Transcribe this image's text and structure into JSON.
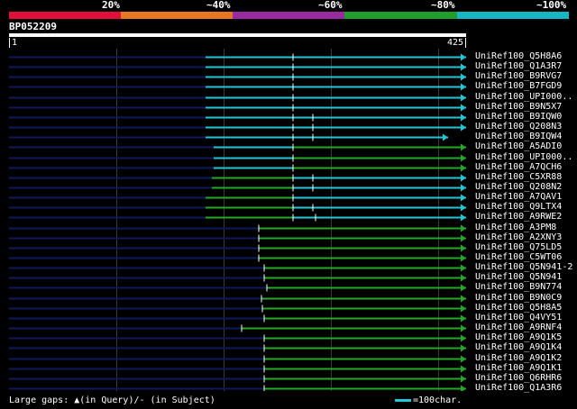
{
  "scale": {
    "segments": [
      {
        "color": "#e0103a"
      },
      {
        "color": "#e87722"
      },
      {
        "color": "#9a2aa0"
      },
      {
        "color": "#1e9e2a"
      },
      {
        "color": "#17b6c2"
      }
    ],
    "labels": [
      "20%",
      "~40%",
      "~60%",
      "~80%",
      "~100%"
    ]
  },
  "query": {
    "id": "BP052209",
    "start": "1",
    "end": "425",
    "length": 425
  },
  "colors": {
    "cyan": "#22c7d6",
    "green": "#23a828",
    "navy": "#101a5a",
    "white": "#ffffff"
  },
  "hits": [
    {
      "label": "UniRef100_Q5H8A6"
    },
    {
      "label": "UniRef100_Q1A3R7"
    },
    {
      "label": "UniRef100_B9RVG7"
    },
    {
      "label": "UniRef100_B7FGD9"
    },
    {
      "label": "UniRef100_UPI000.."
    },
    {
      "label": "UniRef100_B9N5X7"
    },
    {
      "label": "UniRef100_B9IQW0"
    },
    {
      "label": "UniRef100_Q208N3"
    },
    {
      "label": "UniRef100_B9IQW4"
    },
    {
      "label": "UniRef100_A5ADI0"
    },
    {
      "label": "UniRef100_UPI000.."
    },
    {
      "label": "UniRef100_A7QCH6"
    },
    {
      "label": "UniRef100_C5XR88"
    },
    {
      "label": "UniRef100_Q208N2"
    },
    {
      "label": "UniRef100_A7QAV1"
    },
    {
      "label": "UniRef100_Q9LTX4"
    },
    {
      "label": "UniRef100_A9RWE2"
    },
    {
      "label": "UniRef100_A3PM8"
    },
    {
      "label": "UniRef100_A2XNY3"
    },
    {
      "label": "UniRef100_Q75LD5"
    },
    {
      "label": "UniRef100_C5WT06"
    },
    {
      "label": "UniRef100_Q5N941-2"
    },
    {
      "label": "UniRef100_Q5N941"
    },
    {
      "label": "UniRef100_B9N774"
    },
    {
      "label": "UniRef100_B9N0C9"
    },
    {
      "label": "UniRef100_Q5H8A5"
    },
    {
      "label": "UniRef100_Q4VY51"
    },
    {
      "label": "UniRef100_A9RNF4"
    },
    {
      "label": "UniRef100_A9Q1K5"
    },
    {
      "label": "UniRef100_A9Q1K4"
    },
    {
      "label": "UniRef100_A9Q1K2"
    },
    {
      "label": "UniRef100_A9Q1K1"
    },
    {
      "label": "UniRef100_Q6RHR6"
    },
    {
      "label": "UniRef100_Q1A3R6"
    }
  ],
  "footer": {
    "gaps_label": "Large gaps: ▲(in Query)/- (in Subject)",
    "legend_label": "=100char."
  }
}
